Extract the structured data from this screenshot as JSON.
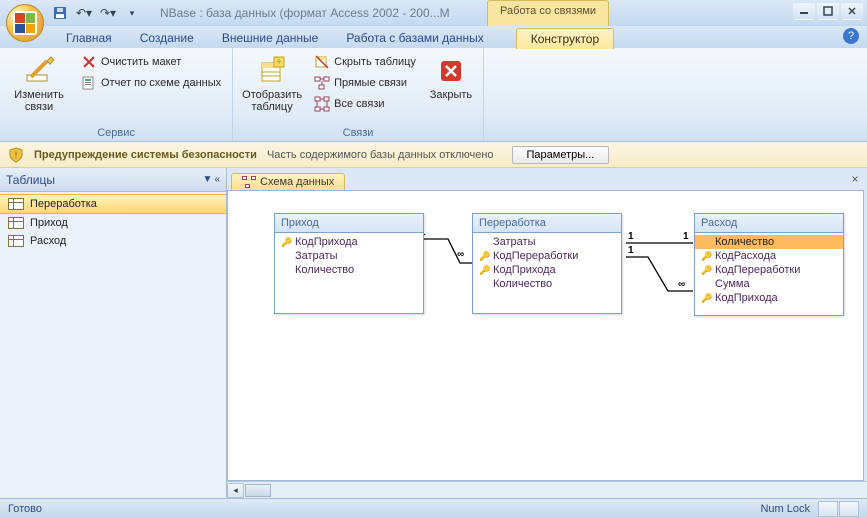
{
  "titlebar": {
    "app_title": "NBase : база данных (формат Access 2002 - 200...M",
    "context_label": "Работа со связями"
  },
  "tabs": {
    "home": "Главная",
    "create": "Создание",
    "external": "Внешние данные",
    "dbtools": "Работа с базами данных",
    "designer": "Конструктор"
  },
  "ribbon": {
    "group1": {
      "label": "Сервис",
      "edit_rel": "Изменить связи",
      "clear_layout": "Очистить макет",
      "schema_report": "Отчет по схеме данных"
    },
    "group2": {
      "label": "Связи",
      "show_table": "Отобразить таблицу",
      "hide_table": "Скрыть таблицу",
      "direct_rel": "Прямые связи",
      "all_rel": "Все связи",
      "close": "Закрыть"
    }
  },
  "security": {
    "title": "Предупреждение системы безопасности",
    "text": "Часть содержимого базы данных отключено",
    "button": "Параметры..."
  },
  "nav": {
    "header": "Таблицы",
    "items": [
      "Переработка",
      "Приход",
      "Расход"
    ]
  },
  "doc_tab": "Схема данных",
  "tables": {
    "t1": {
      "title": "Приход",
      "fields": [
        {
          "key": true,
          "name": "КодПрихода"
        },
        {
          "key": false,
          "name": "Затраты"
        },
        {
          "key": false,
          "name": "Количество"
        }
      ]
    },
    "t2": {
      "title": "Переработка",
      "fields": [
        {
          "key": false,
          "name": "Затраты"
        },
        {
          "key": true,
          "name": "КодПереработки"
        },
        {
          "key": true,
          "name": "КодПрихода"
        },
        {
          "key": false,
          "name": "Количество"
        }
      ]
    },
    "t3": {
      "title": "Расход",
      "fields": [
        {
          "key": false,
          "name": "Количество",
          "selected": true
        },
        {
          "key": true,
          "name": "КодРасхода"
        },
        {
          "key": true,
          "name": "КодПереработки"
        },
        {
          "key": false,
          "name": "Сумма"
        },
        {
          "key": true,
          "name": "КодПрихода"
        }
      ]
    }
  },
  "rel_labels": {
    "one": "1",
    "many": "∞"
  },
  "statusbar": {
    "ready": "Готово",
    "numlock": "Num Lock"
  }
}
